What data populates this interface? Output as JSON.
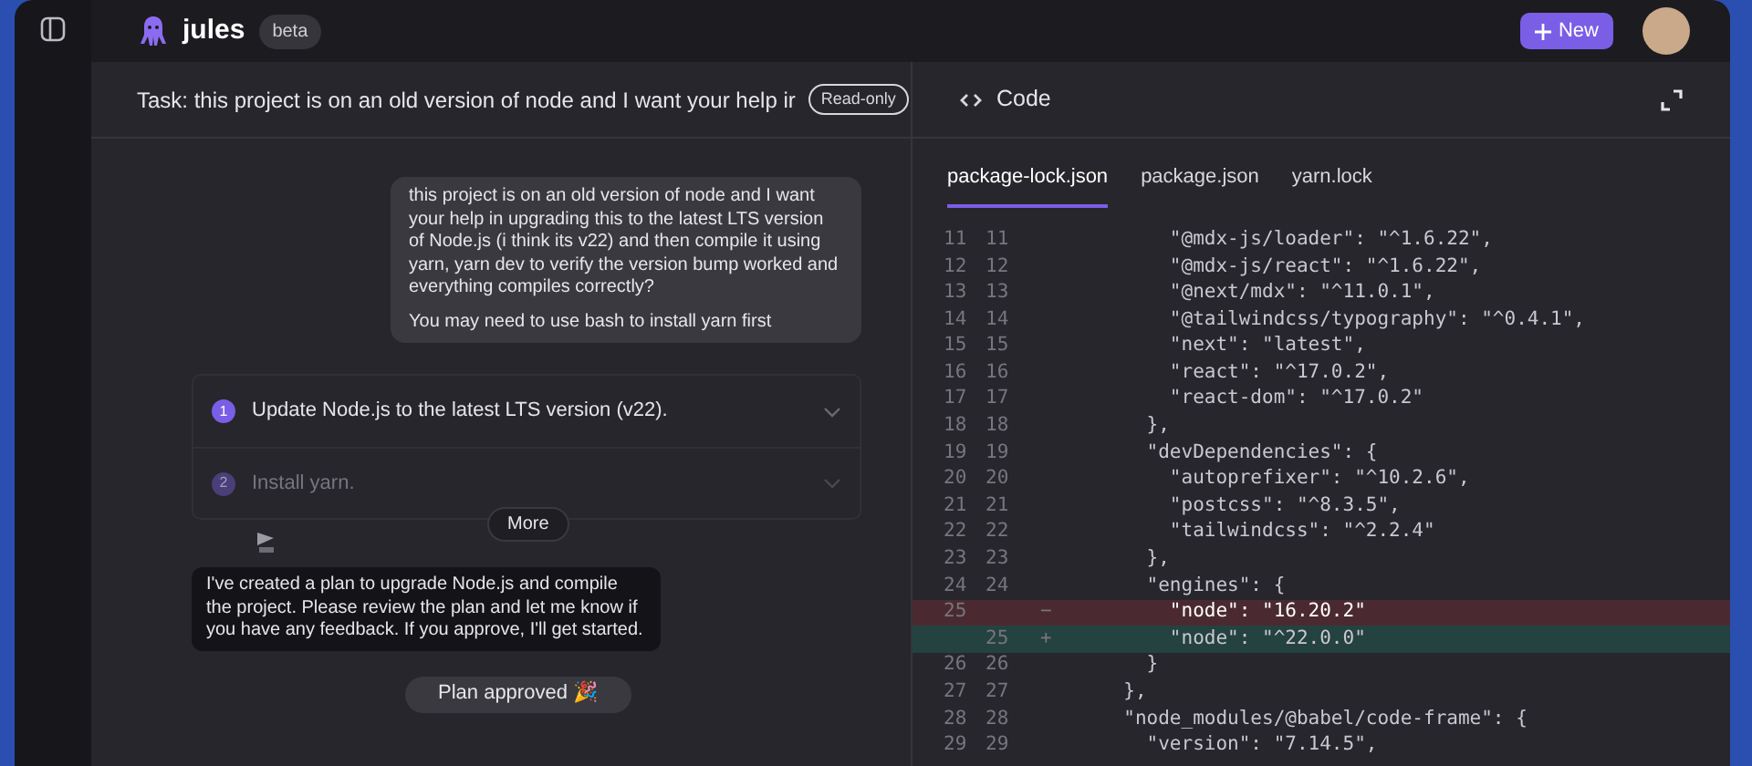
{
  "app": {
    "name": "jules",
    "badge": "beta",
    "new_button": "New"
  },
  "task": {
    "title": "Task: this project is on an old version of node and I want your help ir",
    "badge": "Read-only"
  },
  "chat": {
    "user_message": [
      "this project is on an old version of node and I want your help in upgrading this to the latest LTS version of Node.js (i think its v22) and then compile it using yarn, yarn dev to verify the version bump worked and everything compiles correctly?",
      "You may need to use bash to install yarn first"
    ],
    "plan_steps": [
      {
        "number": "1",
        "label": "Update Node.js to the latest LTS version (v22).",
        "active": true
      },
      {
        "number": "2",
        "label": "Install yarn.",
        "active": false
      }
    ],
    "more_button": "More",
    "agent_message": "I've created a plan to upgrade Node.js and compile the project. Please review the plan and let me know if you have any feedback. If you approve, I'll get started.",
    "status_pill": "Plan approved 🎉"
  },
  "code_panel": {
    "title": "Code",
    "tabs": [
      {
        "label": "package-lock.json",
        "selected": true
      },
      {
        "label": "package.json",
        "selected": false
      },
      {
        "label": "yarn.lock",
        "selected": false
      }
    ],
    "lines": [
      {
        "kind": "same",
        "old": "11",
        "new": "11",
        "text": "      \"@mdx-js/loader\": \"^1.6.22\","
      },
      {
        "kind": "same",
        "old": "12",
        "new": "12",
        "text": "      \"@mdx-js/react\": \"^1.6.22\","
      },
      {
        "kind": "same",
        "old": "13",
        "new": "13",
        "text": "      \"@next/mdx\": \"^11.0.1\","
      },
      {
        "kind": "same",
        "old": "14",
        "new": "14",
        "text": "      \"@tailwindcss/typography\": \"^0.4.1\","
      },
      {
        "kind": "same",
        "old": "15",
        "new": "15",
        "text": "      \"next\": \"latest\","
      },
      {
        "kind": "same",
        "old": "16",
        "new": "16",
        "text": "      \"react\": \"^17.0.2\","
      },
      {
        "kind": "same",
        "old": "17",
        "new": "17",
        "text": "      \"react-dom\": \"^17.0.2\""
      },
      {
        "kind": "same",
        "old": "18",
        "new": "18",
        "text": "    },"
      },
      {
        "kind": "same",
        "old": "19",
        "new": "19",
        "text": "    \"devDependencies\": {"
      },
      {
        "kind": "same",
        "old": "20",
        "new": "20",
        "text": "      \"autoprefixer\": \"^10.2.6\","
      },
      {
        "kind": "same",
        "old": "21",
        "new": "21",
        "text": "      \"postcss\": \"^8.3.5\","
      },
      {
        "kind": "same",
        "old": "22",
        "new": "22",
        "text": "      \"tailwindcss\": \"^2.2.4\""
      },
      {
        "kind": "same",
        "old": "23",
        "new": "23",
        "text": "    },"
      },
      {
        "kind": "same",
        "old": "24",
        "new": "24",
        "text": "    \"engines\": {"
      },
      {
        "kind": "removed",
        "old": "25",
        "sign": "−",
        "text": "      \"node\": \"16.20.2\""
      },
      {
        "kind": "added",
        "new": "25",
        "sign": "+",
        "text": "      \"node\": \"^22.0.0\""
      },
      {
        "kind": "same",
        "old": "26",
        "new": "26",
        "text": "    }"
      },
      {
        "kind": "same",
        "old": "27",
        "new": "27",
        "text": "  },"
      },
      {
        "kind": "same",
        "old": "28",
        "new": "28",
        "text": "  \"node_modules/@babel/code-frame\": {"
      },
      {
        "kind": "same",
        "old": "29",
        "new": "29",
        "text": "    \"version\": \"7.14.5\","
      }
    ]
  }
}
